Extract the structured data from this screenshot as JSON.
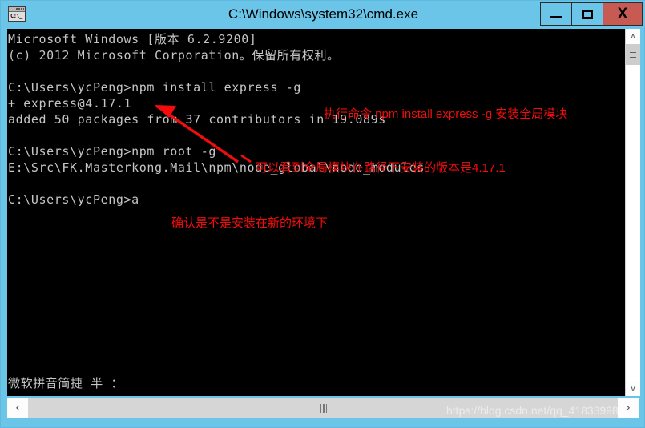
{
  "window": {
    "title": "C:\\Windows\\system32\\cmd.exe",
    "icon": "cmd-window-icon",
    "icon_prompt": "C:\\_",
    "titlebar_color": "#6ac5e8",
    "close_color": "#c75b53",
    "console_bg": "#000000",
    "console_fg": "#c5c5c5",
    "annotation_color": "#f40b0b"
  },
  "titlebar_buttons": {
    "minimize_label": "—",
    "maximize_label": "□",
    "close_label": "X"
  },
  "console": {
    "lines": [
      "Microsoft Windows [版本 6.2.9200]",
      "(c) 2012 Microsoft Corporation。保留所有权利。",
      "",
      "C:\\Users\\ycPeng>npm install express -g",
      "+ express@4.17.1",
      "added 50 packages from 37 contributors in 19.089s",
      "",
      "C:\\Users\\ycPeng>npm root -g",
      "E:\\Src\\FK.Masterkong.Mail\\npm\\node_global\\node_modules",
      "",
      "C:\\Users\\ycPeng>a"
    ],
    "ime_status": "微软拼音简捷 半 ："
  },
  "annotations": [
    {
      "id": "annot-1",
      "text": "执行命令 npm install express -g 安装全局模块"
    },
    {
      "id": "annot-2",
      "text": "可以看到全局模块在路径下安装的版本是4.17.1"
    },
    {
      "id": "annot-3",
      "text": "确认是不是安装在新的环境下"
    }
  ],
  "scrollbars": {
    "v_up": "∧",
    "v_down": "∨",
    "h_left": "‹",
    "h_right": "›"
  },
  "watermark": "https://blog.csdn.net/qq_41833998"
}
